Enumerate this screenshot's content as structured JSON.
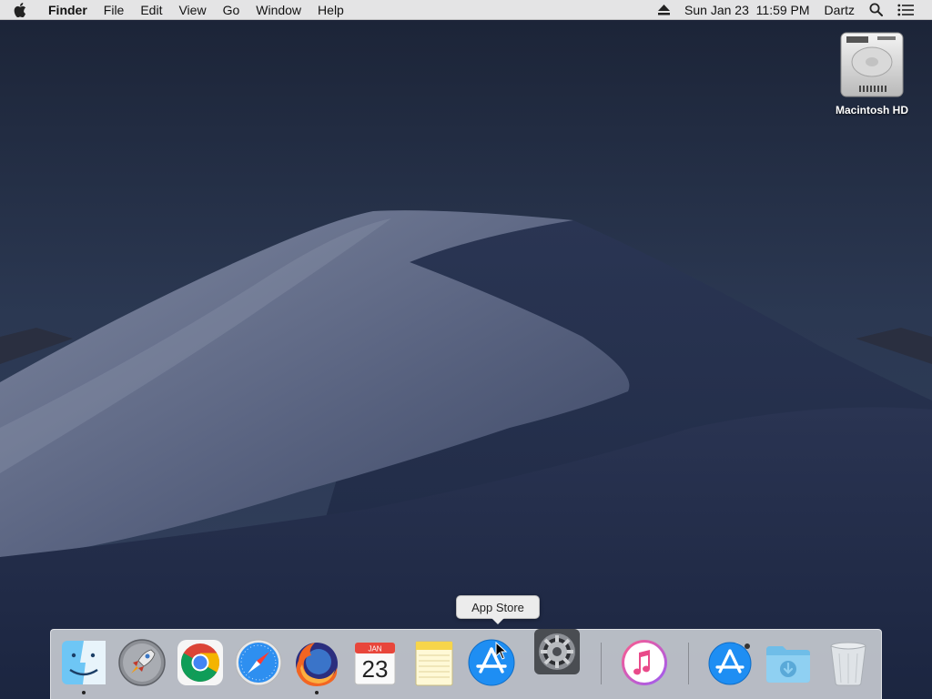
{
  "menubar": {
    "apple_icon": "apple-logo-icon",
    "app_name": "Finder",
    "menus": [
      "File",
      "Edit",
      "View",
      "Go",
      "Window",
      "Help"
    ],
    "eject_icon": "eject-icon",
    "datetime": "Sun Jan 23  11:59 PM",
    "user": "Dartz",
    "search_icon": "spotlight-search-icon",
    "notifications_icon": "notification-center-icon"
  },
  "desktop": {
    "drive_label": "Macintosh HD",
    "drive_icon": "hard-drive-icon"
  },
  "tooltip": {
    "text": "App Store"
  },
  "dock": {
    "calendar_month": "JAN",
    "calendar_day": "23",
    "items": [
      {
        "name": "Finder",
        "icon": "finder-icon",
        "running": true
      },
      {
        "name": "Launchpad",
        "icon": "launchpad-icon",
        "running": false
      },
      {
        "name": "Google Chrome",
        "icon": "chrome-icon",
        "running": false
      },
      {
        "name": "Safari",
        "icon": "safari-icon",
        "running": false
      },
      {
        "name": "Firefox",
        "icon": "firefox-icon",
        "running": true
      },
      {
        "name": "Calendar",
        "icon": "calendar-icon",
        "running": false
      },
      {
        "name": "Notes",
        "icon": "notes-icon",
        "running": false
      },
      {
        "name": "App Store",
        "icon": "app-store-icon",
        "running": false
      },
      {
        "name": "System Preferences",
        "icon": "system-preferences-icon",
        "running": false
      },
      {
        "name": "iTunes",
        "icon": "itunes-icon",
        "running": false
      },
      {
        "name": "App Store (downloads)",
        "icon": "app-store-icon",
        "running": false
      },
      {
        "name": "Downloads",
        "icon": "downloads-folder-icon",
        "running": false
      },
      {
        "name": "Trash",
        "icon": "trash-icon",
        "running": false
      }
    ]
  }
}
